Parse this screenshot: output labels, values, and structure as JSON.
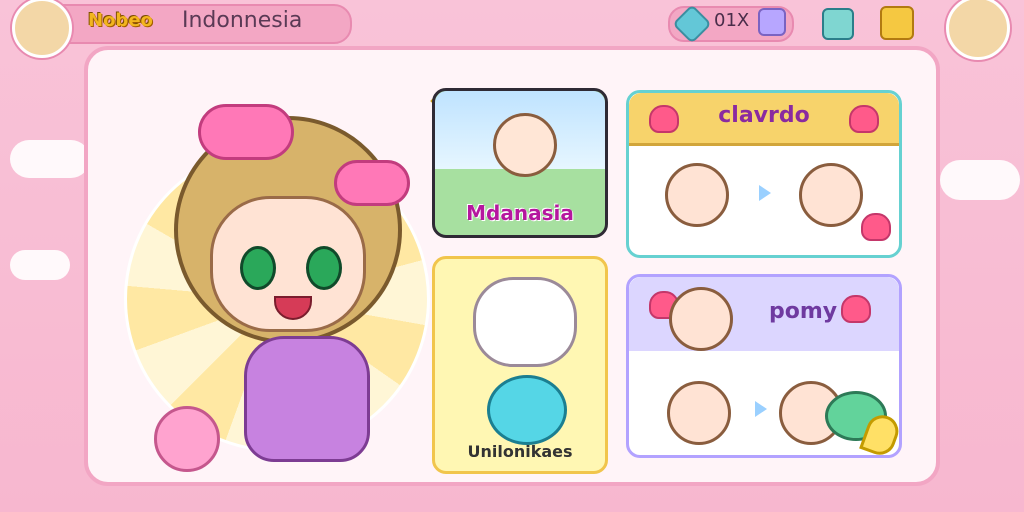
{
  "topbar": {
    "logo": "Nobeo",
    "region": "Indonnesia",
    "currency_amount": "01X"
  },
  "cards": {
    "mdanasia_label": "Mdanasia",
    "clavrdo_title": "clavrdo",
    "cat_label": "Unilonikaes",
    "pomy_title": "pomy"
  },
  "colors": {
    "background": "#f7b7cf",
    "panel": "#fff4f8",
    "accent": "#f2a6c4"
  },
  "icons": {
    "gem": "gem-icon",
    "gift": "gift-icon",
    "puzzle": "puzzle-icon",
    "box": "box-icon"
  }
}
